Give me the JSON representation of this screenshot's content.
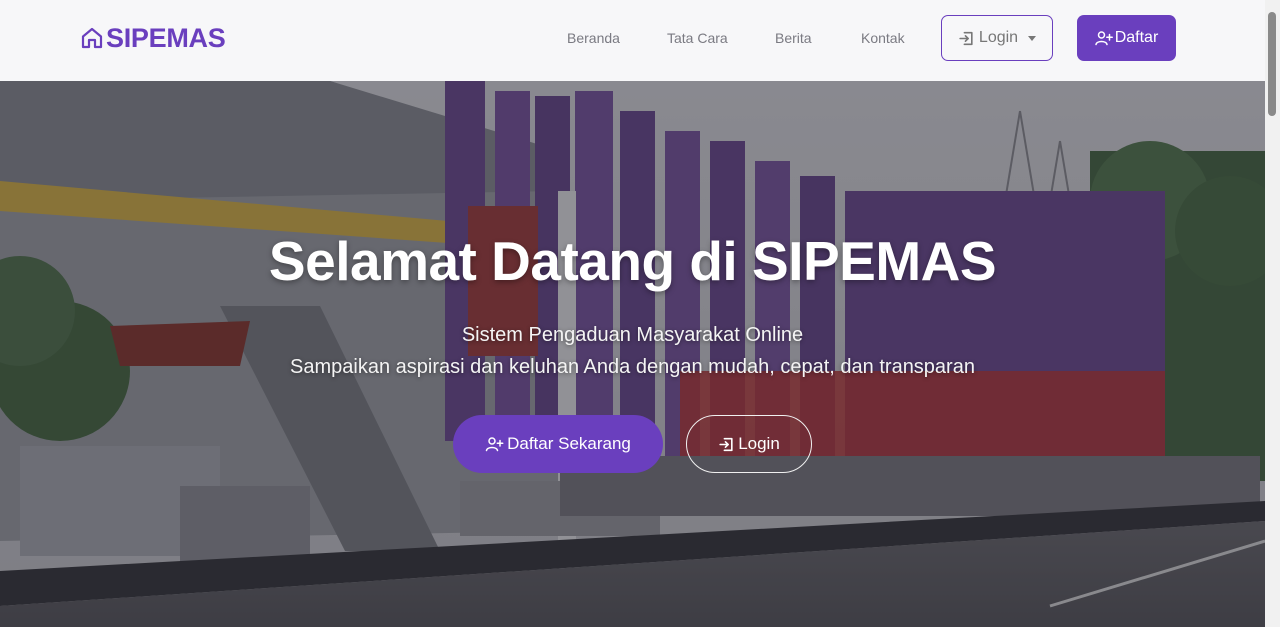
{
  "brand": {
    "name": "SIPEMAS",
    "icon": "home-icon",
    "color": "#6a3fbe"
  },
  "nav": {
    "links": [
      {
        "label": "Beranda"
      },
      {
        "label": "Tata Cara"
      },
      {
        "label": "Berita"
      },
      {
        "label": "Kontak"
      }
    ],
    "login_label": "Login",
    "daftar_label": "Daftar"
  },
  "hero": {
    "title": "Selamat Datang di SIPEMAS",
    "subtitle_line1": "Sistem Pengaduan Masyarakat Online",
    "subtitle_line2": "Sampaikan aspirasi dan keluhan Anda dengan mudah, cepat, dan transparan",
    "primary_button": "Daftar Sekarang",
    "secondary_button": "Login"
  },
  "colors": {
    "accent": "#6a3fbe",
    "navbar_bg": "#f7f7f9",
    "nav_text": "#7a7a82"
  }
}
